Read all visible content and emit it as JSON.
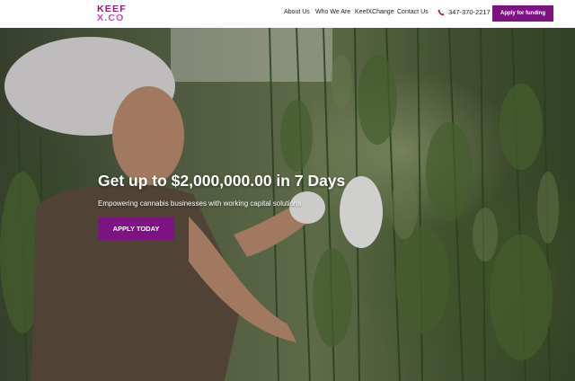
{
  "header": {
    "logo": {
      "line1": "KEEF",
      "line2": "X.CO"
    },
    "nav": [
      {
        "label": "About Us"
      },
      {
        "label": "Who We Are"
      },
      {
        "label": "KeefXChange"
      },
      {
        "label": "Contact Us"
      }
    ],
    "phone": {
      "icon": "phone-icon",
      "number": "347-370-2217"
    },
    "cta_label": "Apply for funding"
  },
  "hero": {
    "headline": "Get up to $2,000,000.00 in 7 Days",
    "subhead": "Empowering cannabis businesses with working capital solutions.",
    "cta_label": "APPLY TODAY",
    "image": "worker-trimming-hanging-cannabis-plants"
  },
  "colors": {
    "brand_purple": "#7d1283",
    "logo_purple": "#8b1a7e",
    "logo_pink": "#c24aa8",
    "text_dark": "#222222",
    "hero_text": "#ffffff"
  }
}
